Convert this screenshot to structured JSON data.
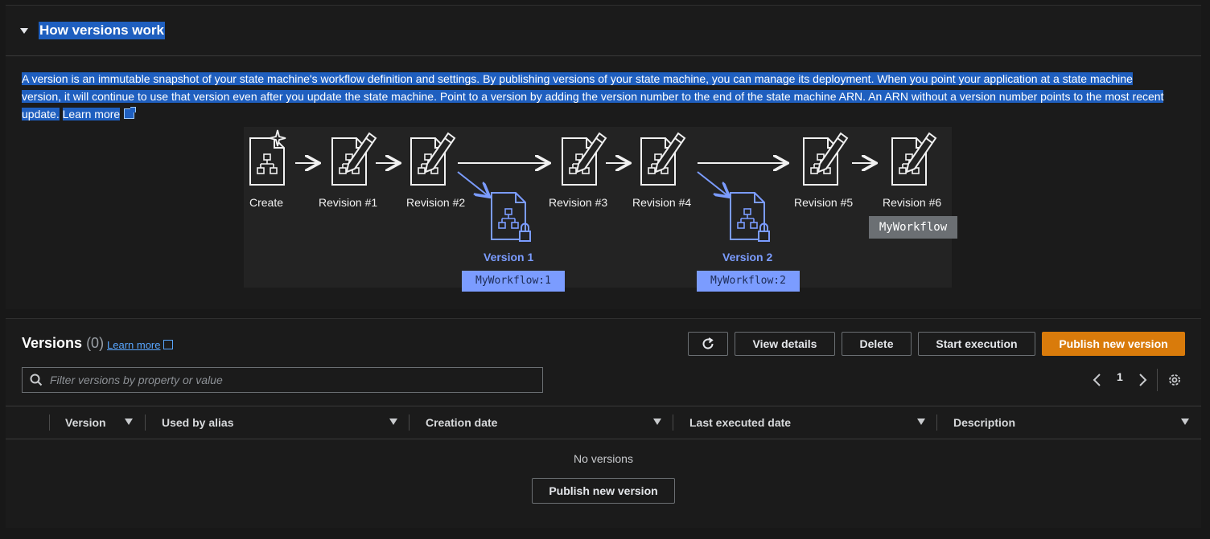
{
  "how_versions": {
    "title": "How versions work",
    "description": "A version is an immutable snapshot of your state machine's workflow definition and settings. By publishing versions of your state machine, you can manage its deployment. When you point your application at a state machine version, it will continue to use that version even after you update the state machine. Point to a version by adding the version number to the end of the state machine ARN. An ARN without a version number points to the most recent update.",
    "learn_more": "Learn more"
  },
  "diagram": {
    "nodes": [
      "Create",
      "Revision #1",
      "Revision #2",
      "Revision #3",
      "Revision #4",
      "Revision #5",
      "Revision #6"
    ],
    "versions": [
      {
        "label": "Version 1",
        "alias": "MyWorkflow:1"
      },
      {
        "label": "Version 2",
        "alias": "MyWorkflow:2"
      }
    ],
    "current": "MyWorkflow",
    "colors": {
      "version": "#7b9cff",
      "current": "#6b6f73"
    }
  },
  "versions_panel": {
    "title": "Versions",
    "count": "(0)",
    "learn_more": "Learn more",
    "buttons": {
      "view_details": "View details",
      "delete": "Delete",
      "start_execution": "Start execution",
      "publish": "Publish new version"
    },
    "search_placeholder": "Filter versions by property or value",
    "page": "1",
    "columns": [
      "Version",
      "Used by alias",
      "Creation date",
      "Last executed date",
      "Description"
    ],
    "empty_text": "No versions",
    "empty_button": "Publish new version",
    "accent": "#d97b0b"
  }
}
